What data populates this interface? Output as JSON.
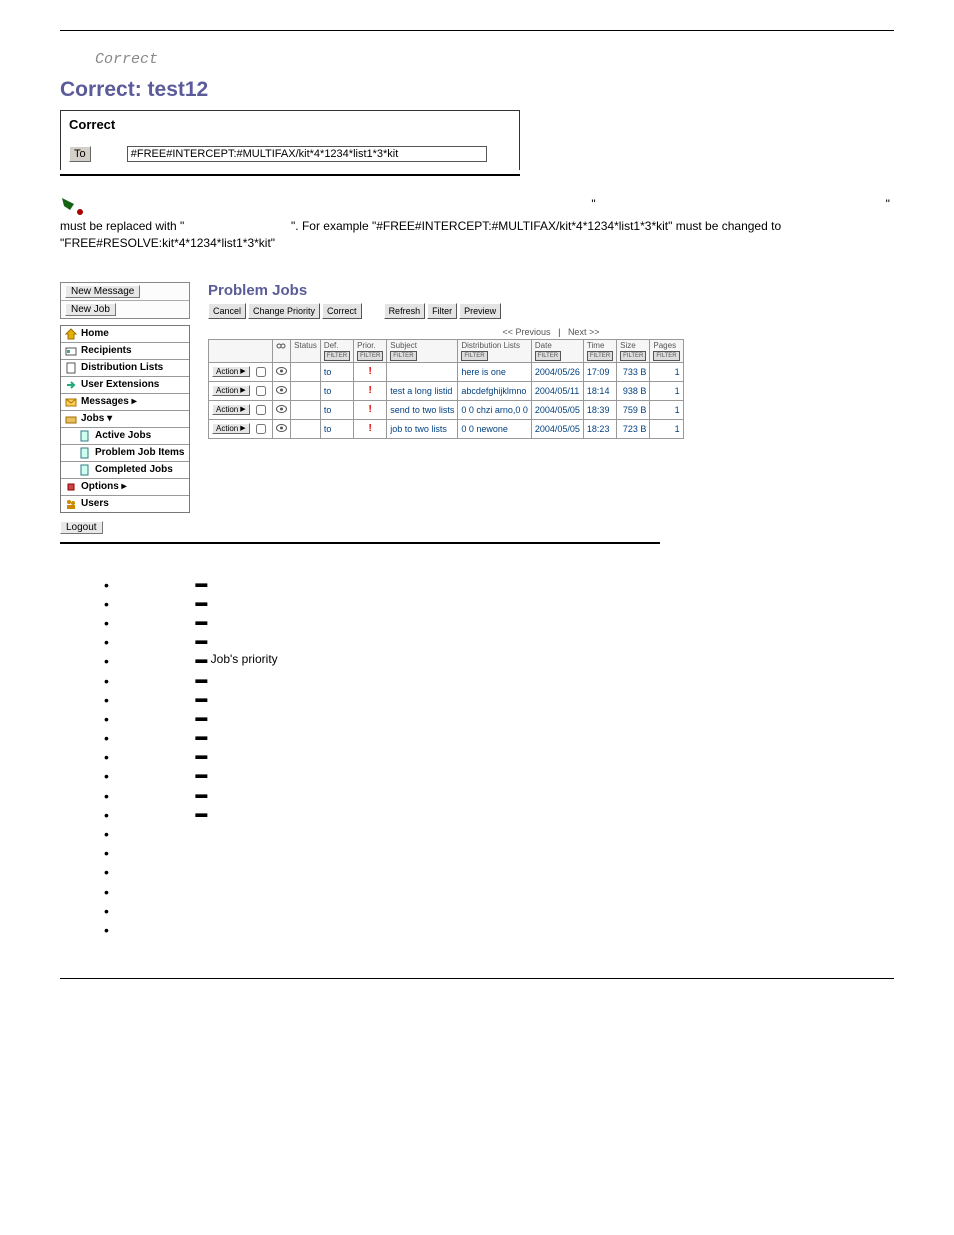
{
  "section_label": "Correct",
  "panel_title": "Correct: test12",
  "correct_box": {
    "header": "Correct",
    "to_button": "To",
    "to_value": "#FREE#INTERCEPT:#MULTIFAX/kit*4*1234*list1*3*kit"
  },
  "note": {
    "prefix_text": "must be replaced with \"",
    "mid_text": "\". For example \"#FREE#INTERCEPT:#MULTIFAX/kit*4*1234*list1*3*kit\" must be changed to",
    "line2": "\"FREE#RESOLVE:kit*4*1234*list1*3*kit\""
  },
  "sidebar": {
    "new_message": "New Message",
    "new_job": "New Job",
    "items": [
      {
        "label": "Home",
        "icon": "home"
      },
      {
        "label": "Recipients",
        "icon": "card"
      },
      {
        "label": "Distribution Lists",
        "icon": "page"
      },
      {
        "label": "User Extensions",
        "icon": "arrow"
      },
      {
        "label": "Messages ▸",
        "icon": "mail"
      },
      {
        "label": "Jobs ▾",
        "icon": "folder"
      },
      {
        "label": "Active Jobs",
        "icon": "doc",
        "sub": true
      },
      {
        "label": "Problem Job Items",
        "icon": "doc",
        "sub": true
      },
      {
        "label": "Completed Jobs",
        "icon": "doc",
        "sub": true
      },
      {
        "label": "Options ▸",
        "icon": "tool"
      },
      {
        "label": "Users",
        "icon": "users"
      }
    ],
    "logout": "Logout"
  },
  "main": {
    "title": "Problem Jobs",
    "toolbar_left": [
      "Cancel",
      "Change Priority",
      "Correct"
    ],
    "toolbar_right": [
      "Refresh",
      "Filter",
      "Preview"
    ],
    "pager": {
      "prev": "<< Previous",
      "sep": "|",
      "next": "Next >>"
    },
    "columns": [
      "",
      "",
      "Status",
      "Def.",
      "Prior.",
      "Subject",
      "Distribution Lists",
      "Date",
      "Time",
      "Size",
      "Pages"
    ],
    "mini_filter": "FILTER",
    "rows": [
      {
        "action": "Action",
        "def": "to",
        "subject": "",
        "lists": "here is one",
        "date": "2004/05/26",
        "time": "17:09",
        "size": "733 B",
        "pages": "1"
      },
      {
        "action": "Action",
        "def": "to",
        "subject": "test a long listid",
        "lists": "abcdefghijklmno",
        "date": "2004/05/11",
        "time": "18:14",
        "size": "938 B",
        "pages": "1"
      },
      {
        "action": "Action",
        "def": "to",
        "subject": "send to two lists",
        "lists": "0 0 chzi arno,0 0",
        "date": "2004/05/05",
        "time": "18:39",
        "size": "759 B",
        "pages": "1"
      },
      {
        "action": "Action",
        "def": "to",
        "subject": "job to two lists",
        "lists": "0 0 newone",
        "date": "2004/05/05",
        "time": "18:23",
        "size": "723 B",
        "pages": "1"
      }
    ]
  },
  "bullets": [
    {
      "dash": " ▬ "
    },
    {
      "dash": " ▬ "
    },
    {
      "dash": " ▬ "
    },
    {
      "dash": " ▬ "
    },
    {
      "dash": " ▬ ",
      "text": "Job's priority"
    },
    {
      "dash": " ▬ "
    },
    {
      "dash": " ▬ "
    },
    {
      "dash": " ▬ "
    },
    {
      "dash": " ▬ "
    },
    {
      "dash": " ▬ "
    },
    {
      "dash": " ▬ "
    },
    {
      "dash": " ▬ "
    },
    {
      "dash": " ▬ "
    },
    {
      "dash": ""
    },
    {
      "dash": ""
    },
    {
      "dash": ""
    },
    {
      "dash": ""
    },
    {
      "dash": ""
    },
    {
      "dash": ""
    }
  ]
}
